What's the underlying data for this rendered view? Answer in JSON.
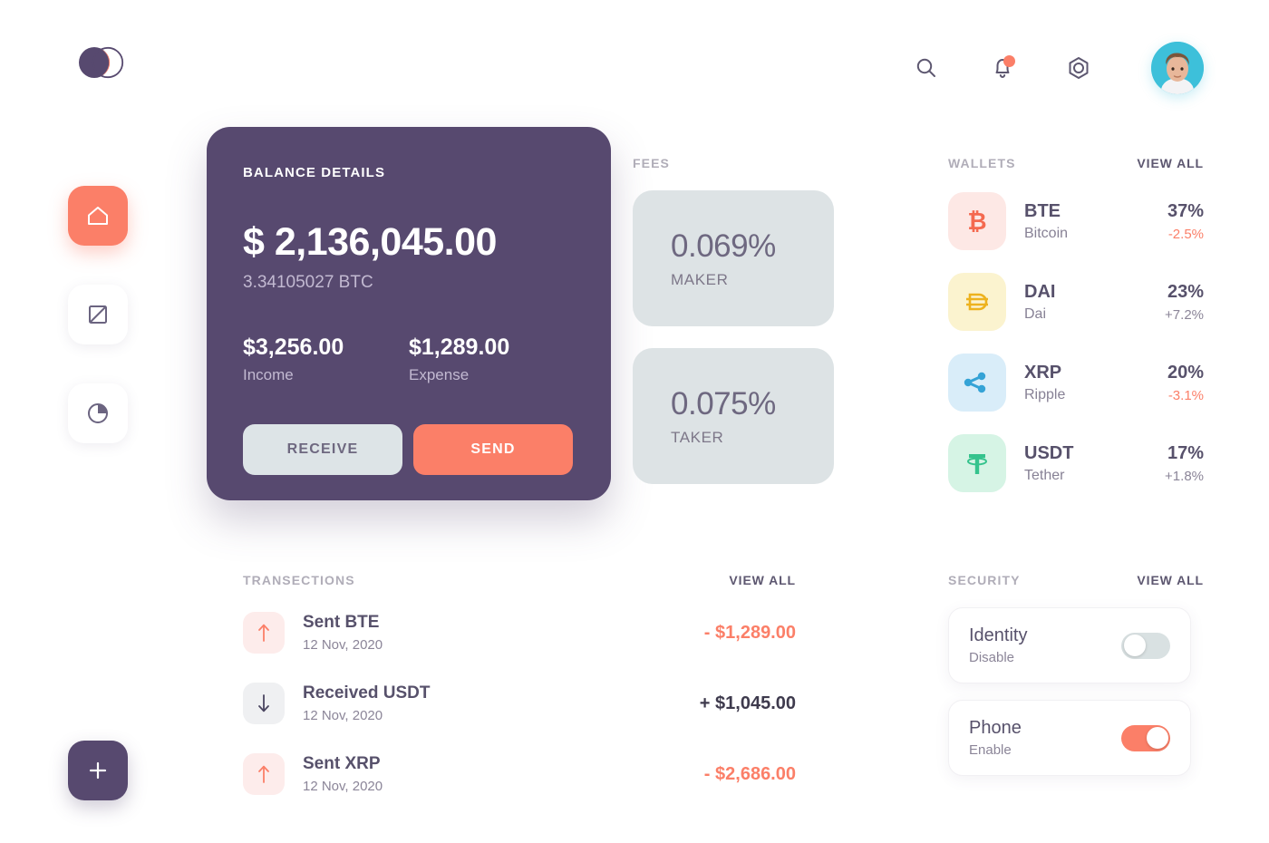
{
  "brand": {
    "logo_name": "overlapping-circles-logo"
  },
  "sidebar": {
    "items": [
      {
        "icon": "home-icon",
        "active": true
      },
      {
        "icon": "exchange-icon",
        "active": false
      },
      {
        "icon": "pie-chart-icon",
        "active": false
      }
    ],
    "add_button_icon": "plus-icon"
  },
  "topbar": {
    "search_icon": "search-icon",
    "notifications_icon": "bell-icon",
    "settings_icon": "gear-hexagon-icon",
    "avatar_name": "user-avatar",
    "avatar_bg": "#3dc0da",
    "has_notification": true
  },
  "balance": {
    "label": "BALANCE DETAILS",
    "amount": "$ 2,136,045.00",
    "btc": "3.34105027 BTC",
    "income_value": "$3,256.00",
    "income_label": "Income",
    "expense_value": "$1,289.00",
    "expense_label": "Expense",
    "receive_label": "RECEIVE",
    "send_label": "SEND",
    "card_color": "#57496f",
    "accent_color": "#fb7f68"
  },
  "fees": {
    "title": "FEES",
    "cards": [
      {
        "value": "0.069%",
        "label": "MAKER"
      },
      {
        "value": "0.075%",
        "label": "TAKER"
      }
    ]
  },
  "wallets": {
    "title": "WALLETS",
    "view_all": "VIEW ALL",
    "items": [
      {
        "symbol": "BTE",
        "name": "Bitcoin",
        "percent": "37%",
        "change": "-2.5%",
        "negative": true,
        "icon": "bitcoin-icon",
        "icon_bg": "#fde8e5",
        "icon_color": "#f4694f"
      },
      {
        "symbol": "DAI",
        "name": "Dai",
        "percent": "23%",
        "change": "+7.2%",
        "negative": false,
        "icon": "dai-icon",
        "icon_bg": "#fbf3cf",
        "icon_color": "#edb21e"
      },
      {
        "symbol": "XRP",
        "name": "Ripple",
        "percent": "20%",
        "change": "-3.1%",
        "negative": true,
        "icon": "ripple-icon",
        "icon_bg": "#d9edf9",
        "icon_color": "#35a3d6"
      },
      {
        "symbol": "USDT",
        "name": "Tether",
        "percent": "17%",
        "change": "+1.8%",
        "negative": false,
        "icon": "tether-icon",
        "icon_bg": "#d6f4e5",
        "icon_color": "#35c38d"
      }
    ]
  },
  "transactions": {
    "title": "TRANSECTIONS",
    "view_all": "VIEW ALL",
    "items": [
      {
        "title": "Sent BTE",
        "date": "12 Nov, 2020",
        "amount": "- $1,289.00",
        "direction": "out",
        "negative": true
      },
      {
        "title": "Received USDT",
        "date": "12 Nov, 2020",
        "amount": "+ $1,045.00",
        "direction": "in",
        "negative": false
      },
      {
        "title": "Sent XRP",
        "date": "12 Nov, 2020",
        "amount": "- $2,686.00",
        "direction": "out",
        "negative": true
      }
    ]
  },
  "security": {
    "title": "SECURITY",
    "view_all": "VIEW ALL",
    "items": [
      {
        "label": "Identity",
        "state": "Disable",
        "enabled": false
      },
      {
        "label": "Phone",
        "state": "Enable",
        "enabled": true
      }
    ]
  }
}
